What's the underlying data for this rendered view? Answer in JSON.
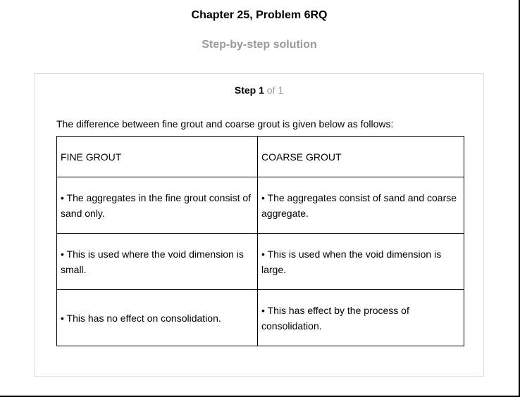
{
  "header": {
    "title": "Chapter 25, Problem 6RQ",
    "subtitle": "Step-by-step solution"
  },
  "step": {
    "label": "Step 1",
    "of_text": "of 1"
  },
  "content": {
    "intro": "The difference between fine grout and coarse grout is given below as follows:",
    "table": {
      "headers": [
        "FINE GROUT",
        "COARSE GROUT"
      ],
      "rows": [
        [
          "• The aggregates in the fine grout consist of sand only.",
          "• The aggregates consist of sand and coarse aggregate."
        ],
        [
          "• This is used where the void dimension is small.",
          "• This is used when the void dimension is large."
        ],
        [
          "• This has no effect on consolidation.",
          "• This has effect by the process of consolidation."
        ]
      ]
    }
  }
}
